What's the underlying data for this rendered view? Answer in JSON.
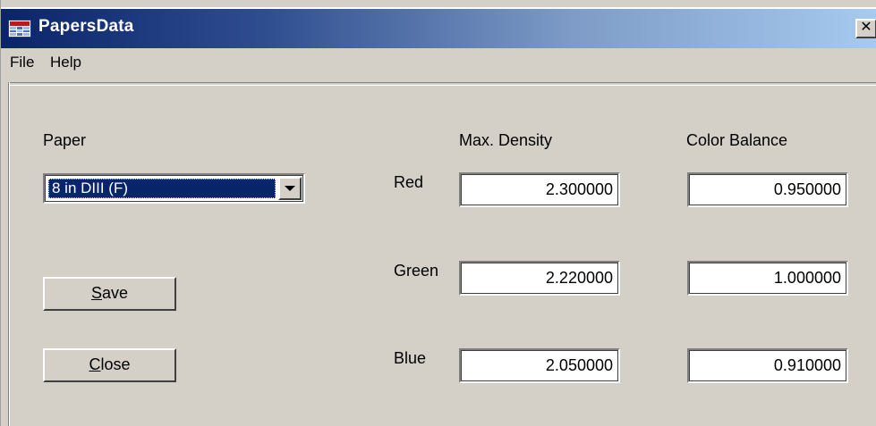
{
  "window": {
    "title": "PapersData",
    "close_glyph": "✕"
  },
  "menu": {
    "items": [
      "File",
      "Help"
    ]
  },
  "form": {
    "paper_label": "Paper",
    "paper_selected": "8 in DIII (F)",
    "max_density_header": "Max. Density",
    "color_balance_header": "Color Balance",
    "rows": [
      {
        "label": "Red",
        "max_density": "2.300000",
        "color_balance": "0.950000"
      },
      {
        "label": "Green",
        "max_density": "2.220000",
        "color_balance": "1.000000"
      },
      {
        "label": "Blue",
        "max_density": "2.050000",
        "color_balance": "0.910000"
      }
    ]
  },
  "buttons": {
    "save_accel": "S",
    "save_rest": "ave",
    "close_accel": "C",
    "close_rest": "lose"
  },
  "icons": {
    "app": "table-icon",
    "dropdown": "chevron-down-icon",
    "close": "close-icon"
  },
  "colors": {
    "title_gradient_start": "#0a246a",
    "title_gradient_end": "#a6caf0",
    "window_face": "#d4d0c8",
    "selection": "#0a246a"
  }
}
